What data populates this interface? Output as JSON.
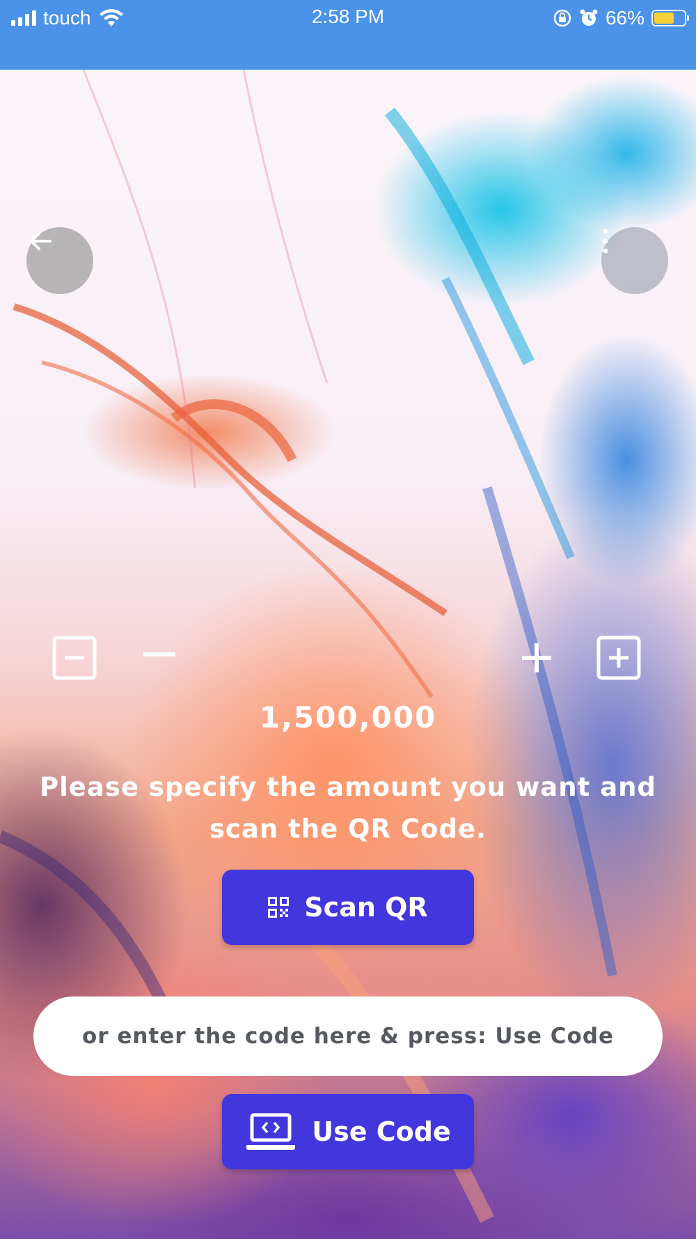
{
  "status_bar": {
    "carrier": "touch",
    "time": "2:58 PM",
    "battery_percent": "66%",
    "battery_level": 0.66,
    "battery_color": "#f7d038",
    "icons": [
      "signal-icon",
      "wifi-icon",
      "orientation-lock-icon",
      "alarm-icon",
      "battery-icon"
    ]
  },
  "colors": {
    "header": "#4a93e9",
    "primary_button": "#4236dd",
    "input_text": "#555a60"
  },
  "header_actions": {
    "back_icon": "arrow-left-icon",
    "menu_icon": "more-vertical-icon"
  },
  "amount": {
    "value": "1,500,000",
    "decrease_large_icon": "minus-square-icon",
    "decrease_icon": "minus-icon",
    "increase_icon": "plus-icon",
    "increase_large_icon": "plus-square-icon"
  },
  "instruction": "Please specify the amount you want and scan the QR Code.",
  "scan_button": {
    "label": "Scan QR",
    "icon": "qr-code-icon"
  },
  "code_input": {
    "placeholder": "or enter the code here & press: Use Code",
    "value": ""
  },
  "use_code_button": {
    "label": "Use Code",
    "icon": "laptop-code-icon"
  }
}
